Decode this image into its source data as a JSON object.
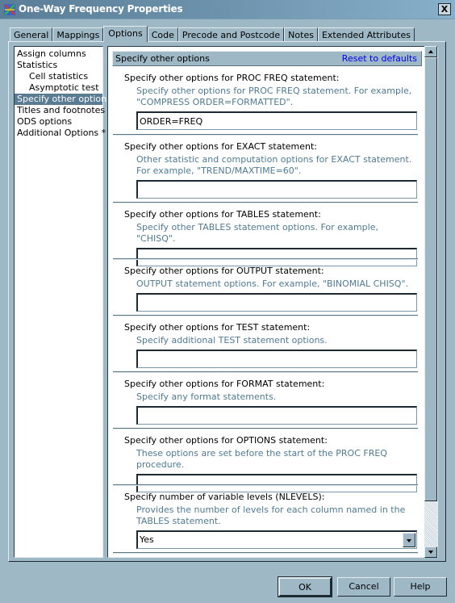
{
  "window": {
    "title": "One-Way Frequency Properties",
    "icon": "sas-task-icon",
    "close_label": "X"
  },
  "tabs": [
    {
      "label": "General",
      "active": false
    },
    {
      "label": "Mappings",
      "active": false
    },
    {
      "label": "Options",
      "active": true
    },
    {
      "label": "Code",
      "active": false
    },
    {
      "label": "Precode and Postcode",
      "active": false
    },
    {
      "label": "Notes",
      "active": false
    },
    {
      "label": "Extended Attributes",
      "active": false
    }
  ],
  "nav": {
    "items": [
      {
        "label": "Assign columns",
        "indent": false,
        "selected": false
      },
      {
        "label": "Statistics",
        "indent": false,
        "selected": false
      },
      {
        "label": "Cell statistics",
        "indent": true,
        "selected": false
      },
      {
        "label": "Asymptotic test",
        "indent": true,
        "selected": false
      },
      {
        "label": "Specify other options",
        "indent": false,
        "selected": true
      },
      {
        "label": "Titles and footnotes",
        "indent": false,
        "selected": false
      },
      {
        "label": "ODS options",
        "indent": false,
        "selected": false
      },
      {
        "label": "Additional Options *",
        "indent": false,
        "selected": false
      }
    ]
  },
  "section": {
    "title": "Specify other options",
    "reset_label": "Reset to defaults"
  },
  "groups": [
    {
      "label": "Specify other options for PROC FREQ statement:",
      "description": "Specify other options for PROC FREQ statement. For example, \"COMPRESS ORDER=FORMATTED\".",
      "value": "ORDER=FREQ"
    },
    {
      "label": "Specify other options for EXACT statement:",
      "description": "Other statistic and computation options for EXACT statement.  For example, \"TREND/MAXTIME=60\".",
      "value": ""
    },
    {
      "label": "Specify other options for TABLES statement:",
      "description": "Specify other TABLES statement options.  For example, \"CHISQ\".",
      "value": ""
    },
    {
      "label": "Specify other options for OUTPUT statement:",
      "description": "OUTPUT statement options. For example, \"BINOMIAL CHISQ\".",
      "value": ""
    },
    {
      "label": "Specify other options for TEST statement:",
      "description": "Specify additional TEST statement options.",
      "value": ""
    },
    {
      "label": "Specify other options for FORMAT statement:",
      "description": "Specify any format statements.",
      "value": ""
    },
    {
      "label": "Specify other options for OPTIONS statement:",
      "description": "These options are set before the start of the PROC FREQ procedure.",
      "value": ""
    },
    {
      "label": "Specify number of variable levels (NLEVELS):",
      "description": "Provides the number of levels for each column named in the TABLES statement.",
      "selected": "Yes"
    }
  ],
  "buttons": {
    "ok": "OK",
    "cancel": "Cancel",
    "help": "Help"
  },
  "colors": {
    "dialog_bg": "#9fb8c6",
    "selection": "#5a7c92",
    "link": "#0000ee",
    "description_text": "#4f7a93"
  }
}
